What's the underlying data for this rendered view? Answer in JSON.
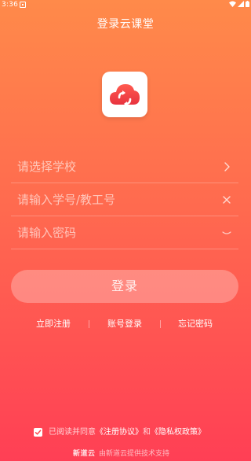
{
  "status_bar": {
    "time": "3:36",
    "icons": [
      "notification-icon",
      "wifi-icon",
      "cell-signal-icon",
      "battery-icon"
    ]
  },
  "page": {
    "title": "登录云课堂"
  },
  "app_logo": {
    "icon": "cloud-refresh-icon",
    "colors": {
      "primary": "#F0414B"
    }
  },
  "form": {
    "school_placeholder": "请选择学校",
    "school_icon": "chevron-right-icon",
    "id_placeholder": "请输入学号/教工号",
    "id_icon": "clear-icon",
    "password_placeholder": "请输入密码",
    "password_icon": "eye-closed-icon"
  },
  "login_button": {
    "label": "登录"
  },
  "links": {
    "register": "立即注册",
    "account_login": "账号登录",
    "forgot_password": "忘记密码"
  },
  "agreement": {
    "checked": true,
    "prefix": "已阅读并同意",
    "terms": "《注册协议》",
    "conjunction": "和",
    "privacy": "《隐私权政策》"
  },
  "footer": {
    "logo": "新道云",
    "text": "由新道云提供技术支持"
  },
  "colors": {
    "gradient_top": "#FF8A4A",
    "gradient_bottom": "#FF3F55"
  }
}
